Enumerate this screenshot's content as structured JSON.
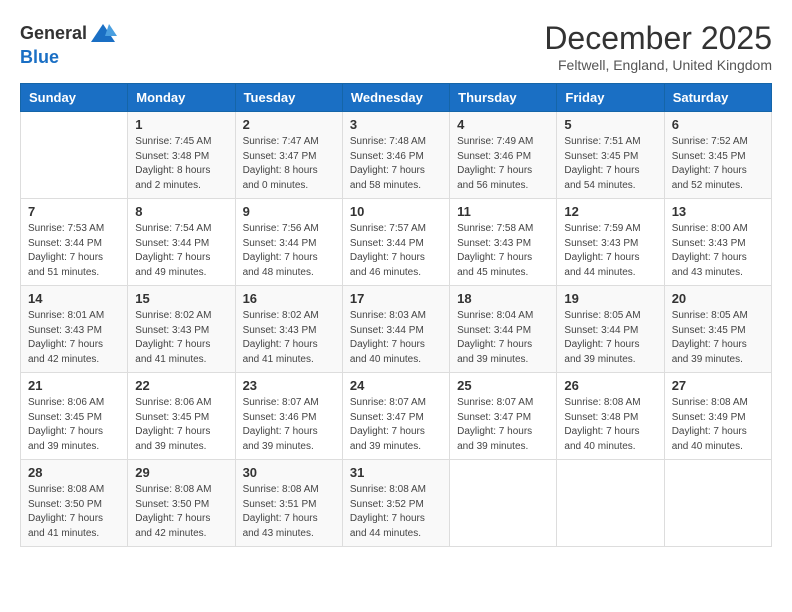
{
  "header": {
    "logo_general": "General",
    "logo_blue": "Blue",
    "month_title": "December 2025",
    "location": "Feltwell, England, United Kingdom"
  },
  "days_of_week": [
    "Sunday",
    "Monday",
    "Tuesday",
    "Wednesday",
    "Thursday",
    "Friday",
    "Saturday"
  ],
  "weeks": [
    [
      {
        "day": "",
        "info": ""
      },
      {
        "day": "1",
        "info": "Sunrise: 7:45 AM\nSunset: 3:48 PM\nDaylight: 8 hours\nand 2 minutes."
      },
      {
        "day": "2",
        "info": "Sunrise: 7:47 AM\nSunset: 3:47 PM\nDaylight: 8 hours\nand 0 minutes."
      },
      {
        "day": "3",
        "info": "Sunrise: 7:48 AM\nSunset: 3:46 PM\nDaylight: 7 hours\nand 58 minutes."
      },
      {
        "day": "4",
        "info": "Sunrise: 7:49 AM\nSunset: 3:46 PM\nDaylight: 7 hours\nand 56 minutes."
      },
      {
        "day": "5",
        "info": "Sunrise: 7:51 AM\nSunset: 3:45 PM\nDaylight: 7 hours\nand 54 minutes."
      },
      {
        "day": "6",
        "info": "Sunrise: 7:52 AM\nSunset: 3:45 PM\nDaylight: 7 hours\nand 52 minutes."
      }
    ],
    [
      {
        "day": "7",
        "info": "Sunrise: 7:53 AM\nSunset: 3:44 PM\nDaylight: 7 hours\nand 51 minutes."
      },
      {
        "day": "8",
        "info": "Sunrise: 7:54 AM\nSunset: 3:44 PM\nDaylight: 7 hours\nand 49 minutes."
      },
      {
        "day": "9",
        "info": "Sunrise: 7:56 AM\nSunset: 3:44 PM\nDaylight: 7 hours\nand 48 minutes."
      },
      {
        "day": "10",
        "info": "Sunrise: 7:57 AM\nSunset: 3:44 PM\nDaylight: 7 hours\nand 46 minutes."
      },
      {
        "day": "11",
        "info": "Sunrise: 7:58 AM\nSunset: 3:43 PM\nDaylight: 7 hours\nand 45 minutes."
      },
      {
        "day": "12",
        "info": "Sunrise: 7:59 AM\nSunset: 3:43 PM\nDaylight: 7 hours\nand 44 minutes."
      },
      {
        "day": "13",
        "info": "Sunrise: 8:00 AM\nSunset: 3:43 PM\nDaylight: 7 hours\nand 43 minutes."
      }
    ],
    [
      {
        "day": "14",
        "info": "Sunrise: 8:01 AM\nSunset: 3:43 PM\nDaylight: 7 hours\nand 42 minutes."
      },
      {
        "day": "15",
        "info": "Sunrise: 8:02 AM\nSunset: 3:43 PM\nDaylight: 7 hours\nand 41 minutes."
      },
      {
        "day": "16",
        "info": "Sunrise: 8:02 AM\nSunset: 3:43 PM\nDaylight: 7 hours\nand 41 minutes."
      },
      {
        "day": "17",
        "info": "Sunrise: 8:03 AM\nSunset: 3:44 PM\nDaylight: 7 hours\nand 40 minutes."
      },
      {
        "day": "18",
        "info": "Sunrise: 8:04 AM\nSunset: 3:44 PM\nDaylight: 7 hours\nand 39 minutes."
      },
      {
        "day": "19",
        "info": "Sunrise: 8:05 AM\nSunset: 3:44 PM\nDaylight: 7 hours\nand 39 minutes."
      },
      {
        "day": "20",
        "info": "Sunrise: 8:05 AM\nSunset: 3:45 PM\nDaylight: 7 hours\nand 39 minutes."
      }
    ],
    [
      {
        "day": "21",
        "info": "Sunrise: 8:06 AM\nSunset: 3:45 PM\nDaylight: 7 hours\nand 39 minutes."
      },
      {
        "day": "22",
        "info": "Sunrise: 8:06 AM\nSunset: 3:45 PM\nDaylight: 7 hours\nand 39 minutes."
      },
      {
        "day": "23",
        "info": "Sunrise: 8:07 AM\nSunset: 3:46 PM\nDaylight: 7 hours\nand 39 minutes."
      },
      {
        "day": "24",
        "info": "Sunrise: 8:07 AM\nSunset: 3:47 PM\nDaylight: 7 hours\nand 39 minutes."
      },
      {
        "day": "25",
        "info": "Sunrise: 8:07 AM\nSunset: 3:47 PM\nDaylight: 7 hours\nand 39 minutes."
      },
      {
        "day": "26",
        "info": "Sunrise: 8:08 AM\nSunset: 3:48 PM\nDaylight: 7 hours\nand 40 minutes."
      },
      {
        "day": "27",
        "info": "Sunrise: 8:08 AM\nSunset: 3:49 PM\nDaylight: 7 hours\nand 40 minutes."
      }
    ],
    [
      {
        "day": "28",
        "info": "Sunrise: 8:08 AM\nSunset: 3:50 PM\nDaylight: 7 hours\nand 41 minutes."
      },
      {
        "day": "29",
        "info": "Sunrise: 8:08 AM\nSunset: 3:50 PM\nDaylight: 7 hours\nand 42 minutes."
      },
      {
        "day": "30",
        "info": "Sunrise: 8:08 AM\nSunset: 3:51 PM\nDaylight: 7 hours\nand 43 minutes."
      },
      {
        "day": "31",
        "info": "Sunrise: 8:08 AM\nSunset: 3:52 PM\nDaylight: 7 hours\nand 44 minutes."
      },
      {
        "day": "",
        "info": ""
      },
      {
        "day": "",
        "info": ""
      },
      {
        "day": "",
        "info": ""
      }
    ]
  ]
}
